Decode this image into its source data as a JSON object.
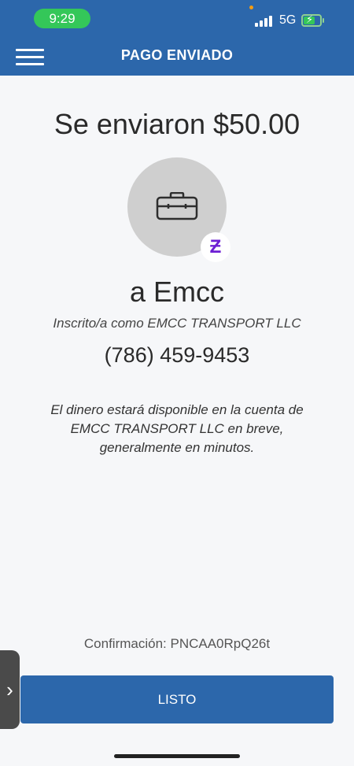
{
  "status_bar": {
    "time": "9:29",
    "network": "5G",
    "battery_charging": true
  },
  "nav": {
    "title": "PAGO ENVIADO",
    "menu_icon": "hamburger-menu-icon"
  },
  "payment": {
    "amount_text": "Se enviaron $50.00",
    "avatar_icon": "briefcase-icon",
    "badge_icon": "zelle-z-icon",
    "badge_glyph": "Ƶ",
    "recipient": "a Emcc",
    "enrolled_as": "Inscrito/a como EMCC TRANSPORT LLC",
    "phone": "(786) 459-9453",
    "note": "El dinero estará disponible en la cuenta de EMCC TRANSPORT LLC en breve, generalmente en minutos."
  },
  "confirmation": {
    "text": "Confirmación: PNCAA0RpQ26t"
  },
  "actions": {
    "done_label": "LISTO",
    "side_handle_glyph": "›"
  },
  "colors": {
    "brand_blue": "#2c67ab",
    "status_green": "#34c759",
    "zelle_purple": "#6d1ed4",
    "background": "#f6f7f9"
  }
}
